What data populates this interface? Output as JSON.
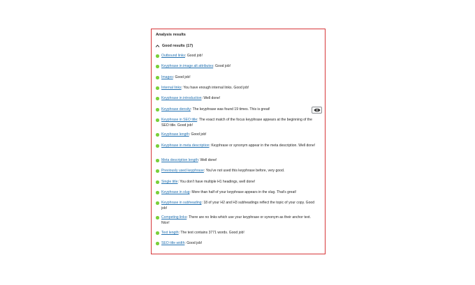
{
  "panel": {
    "title": "Analysis results"
  },
  "group": {
    "label": "Good results",
    "count": "(17)"
  },
  "items": [
    {
      "link": "Outbound links",
      "text": ": Good job!"
    },
    {
      "link": "Keyphrase in image alt attributes",
      "text": ": Good job!"
    },
    {
      "link": "Images",
      "text": ": Good job!"
    },
    {
      "link": "Internal links",
      "text": ": You have enough internal links. Good job!"
    },
    {
      "link": "Keyphrase in introduction",
      "text": ": Well done!"
    },
    {
      "link": "Keyphrase density",
      "text": ": The keyphrase was found 19 times. This is great!"
    },
    {
      "link": "Keyphrase in SEO title",
      "text": ": The exact match of the focus keyphrase appears at the beginning of the SEO title. Good job!"
    },
    {
      "link": "Keyphrase length",
      "text": ": Good job!"
    },
    {
      "link": "Keyphrase in meta description",
      "text": ": Keyphrase or synonym appear in the meta description. Well done!"
    },
    {
      "link": "Meta description length",
      "text": ": Well done!"
    },
    {
      "link": "Previously used keyphrase",
      "text": ": You've not used this keyphrase before, very good."
    },
    {
      "link": "Single title",
      "text": ": You don't have multiple H1 headings, well done!"
    },
    {
      "link": "Keyphrase in slug",
      "text": ": More than half of your keyphrase appears in the slug. That's great!"
    },
    {
      "link": "Keyphrase in subheading",
      "text": ": 18 of your H2 and H3 subheadings reflect the topic of your copy. Good job!"
    },
    {
      "link": "Competing links",
      "text": ": There are no links which use your keyphrase or synonym as their anchor text. Nice!"
    },
    {
      "link": "Text length",
      "text": ": The text contains 3771 words. Good job!"
    },
    {
      "link": "SEO title width",
      "text": ": Good job!"
    }
  ],
  "colors": {
    "panel_border": "#d63638",
    "good_dot": "#7ad03a",
    "link": "#2271b1"
  },
  "icons": {
    "collapse": "chevron-up-icon",
    "status": "green-dot-icon",
    "highlight": "eye-icon"
  }
}
